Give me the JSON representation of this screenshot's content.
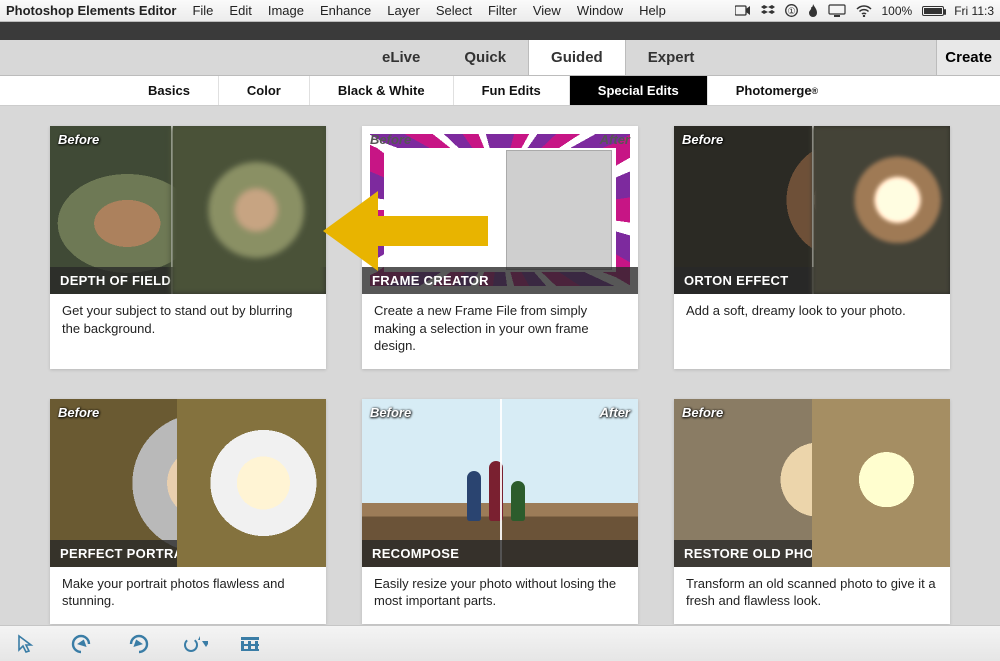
{
  "menubar": {
    "app": "Photoshop Elements Editor",
    "items": [
      "File",
      "Edit",
      "Image",
      "Enhance",
      "Layer",
      "Select",
      "Filter",
      "View",
      "Window",
      "Help"
    ],
    "battery_pct": "100%",
    "clock": "Fri 11:3"
  },
  "modes": {
    "elive": "eLive",
    "quick": "Quick",
    "guided": "Guided",
    "expert": "Expert",
    "create": "Create"
  },
  "subnav": {
    "basics": "Basics",
    "color": "Color",
    "bw": "Black & White",
    "fun": "Fun Edits",
    "special": "Special Edits",
    "photomerge": "Photomerge"
  },
  "labels": {
    "before": "Before",
    "after": "After"
  },
  "cards": {
    "dof": {
      "title": "DEPTH OF FIELD",
      "desc": "Get your subject to stand out by blurring the background."
    },
    "frame": {
      "title": "FRAME CREATOR",
      "desc": "Create a new Frame File from simply making a selection in your own frame design."
    },
    "orton": {
      "title": "ORTON EFFECT",
      "desc": "Add a soft, dreamy look to your photo."
    },
    "portrait": {
      "title": "PERFECT PORTRAIT",
      "desc": "Make your portrait photos flawless and stunning."
    },
    "recompose": {
      "title": "RECOMPOSE",
      "desc": "Easily resize your photo without losing the most important parts."
    },
    "restore": {
      "title": "RESTORE OLD PHOTO",
      "desc": "Transform an old scanned photo to give it a fresh and flawless look."
    }
  }
}
